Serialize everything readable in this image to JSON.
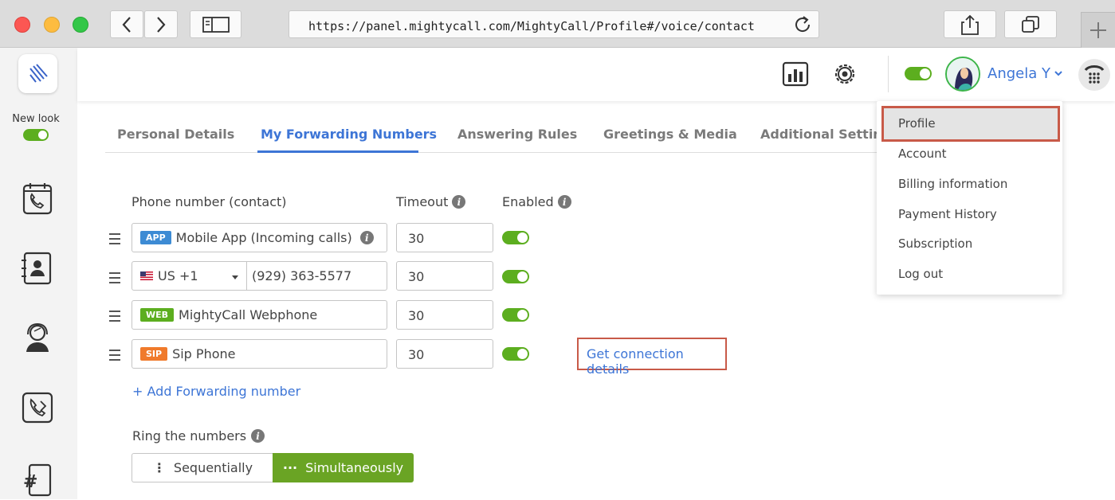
{
  "browser": {
    "url": "https://panel.mightycall.com/MightyCall/Profile#/voice/contact"
  },
  "sidebar": {
    "new_look_label": "New look"
  },
  "header": {
    "user_name": "Angela Y"
  },
  "tabs": [
    {
      "label": "Personal Details"
    },
    {
      "label": "My Forwarding Numbers"
    },
    {
      "label": "Answering Rules"
    },
    {
      "label": "Greetings & Media"
    },
    {
      "label": "Additional Settings"
    }
  ],
  "columns": {
    "phone": "Phone number (contact)",
    "timeout": "Timeout",
    "enabled": "Enabled"
  },
  "rows": [
    {
      "badge": "APP",
      "badge_color": "#3d8bd4",
      "label": "Mobile App (Incoming calls)",
      "timeout": "30",
      "enabled": true
    },
    {
      "country": "US +1",
      "number": "(929) 363-5577",
      "timeout": "30",
      "enabled": true
    },
    {
      "badge": "WEB",
      "badge_color": "#5cae1f",
      "label": "MightyCall Webphone",
      "timeout": "30",
      "enabled": true
    },
    {
      "badge": "SIP",
      "badge_color": "#f07a2b",
      "label": "Sip Phone",
      "timeout": "30",
      "enabled": true
    }
  ],
  "get_connection_details": "Get connection details",
  "add_forwarding": "+ Add Forwarding number",
  "ring": {
    "label": "Ring the numbers",
    "sequential": "Sequentially",
    "simultaneous": "Simultaneously",
    "selected": "Simultaneously"
  },
  "user_menu": {
    "items": [
      "Profile",
      "Account",
      "Billing information",
      "Payment History",
      "Subscription",
      "Log out"
    ],
    "highlighted": "Profile"
  },
  "colors": {
    "accent": "#3d75d6",
    "toggle_on": "#5cae1f",
    "highlight_border": "#c85a48",
    "selected_segment": "#6aa424"
  }
}
